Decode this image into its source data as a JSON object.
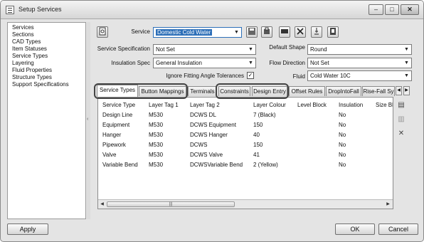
{
  "window": {
    "title": "Setup Services",
    "minimize": "–",
    "maximize": "□",
    "close": "✕"
  },
  "sidebar": {
    "items": [
      {
        "label": "Services"
      },
      {
        "label": "Sections"
      },
      {
        "label": "CAD Types"
      },
      {
        "label": "Item Statuses"
      },
      {
        "label": "Service Types"
      },
      {
        "label": "Layering"
      },
      {
        "label": "Fluid Properties"
      },
      {
        "label": "Structure Types"
      },
      {
        "label": "Support Specifications"
      }
    ],
    "splitter_arrow": "‹"
  },
  "form": {
    "service_label": "Service",
    "service_value": "Domestic Cold Water",
    "service_spec_label": "Service Specification",
    "service_spec_value": "Not Set",
    "default_shape_label": "Default Shape",
    "default_shape_value": "Round",
    "insulation_label": "Insulation Spec",
    "insulation_value": "General Insulation",
    "flow_label": "Flow Direction",
    "flow_value": "Not Set",
    "ignore_label": "Ignore Fitting Angle Tolerances",
    "ignore_checked": "✓",
    "fluid_label": "Fluid",
    "fluid_value": "Cold Water 10C",
    "caret": "▼"
  },
  "toolbar": {
    "icons": [
      "page-icon",
      "save-icon",
      "copy-icon",
      "export-icon",
      "delete-icon",
      "stamp-icon",
      "info-icon"
    ]
  },
  "tabs": [
    {
      "label": "Service Types",
      "active": true
    },
    {
      "label": "Button Mappings"
    },
    {
      "label": "Terminals"
    },
    {
      "label": "Constraints"
    },
    {
      "label": "Design Entry"
    },
    {
      "label": "Offset Rules"
    },
    {
      "label": "DropIntoFall"
    },
    {
      "label": "Rise-Fall Sy"
    }
  ],
  "tab_arrows": {
    "left": "◀",
    "right": "▶"
  },
  "table": {
    "columns": [
      "Service Type",
      "Layer Tag 1",
      "Layer Tag 2",
      "Layer Colour",
      "Level Block",
      "Insulation",
      "Size Bl"
    ],
    "rows": [
      [
        "Design Line",
        "M530",
        "DCWS DL",
        "7 (Black)",
        "",
        "No",
        ""
      ],
      [
        "Equipment",
        "M530",
        "DCWS Equipment",
        "150",
        "",
        "No",
        ""
      ],
      [
        "Hanger",
        "M530",
        "DCWS Hanger",
        "40",
        "",
        "No",
        ""
      ],
      [
        "Pipework",
        "M530",
        "DCWS",
        "150",
        "",
        "No",
        ""
      ],
      [
        "Valve",
        "M530",
        "DCWS Valve",
        "41",
        "",
        "No",
        ""
      ],
      [
        "Variable Bend",
        "M530",
        "DCWSVariable Bend",
        "2 (Yellow)",
        "",
        "No",
        ""
      ]
    ],
    "scroll_left": "◀",
    "scroll_right": "▶",
    "scroll_grip": "|||"
  },
  "side_buttons": {
    "add": "▤",
    "copy": "▥",
    "delete": "✕"
  },
  "footer": {
    "apply": "Apply",
    "ok": "OK",
    "cancel": "Cancel"
  }
}
